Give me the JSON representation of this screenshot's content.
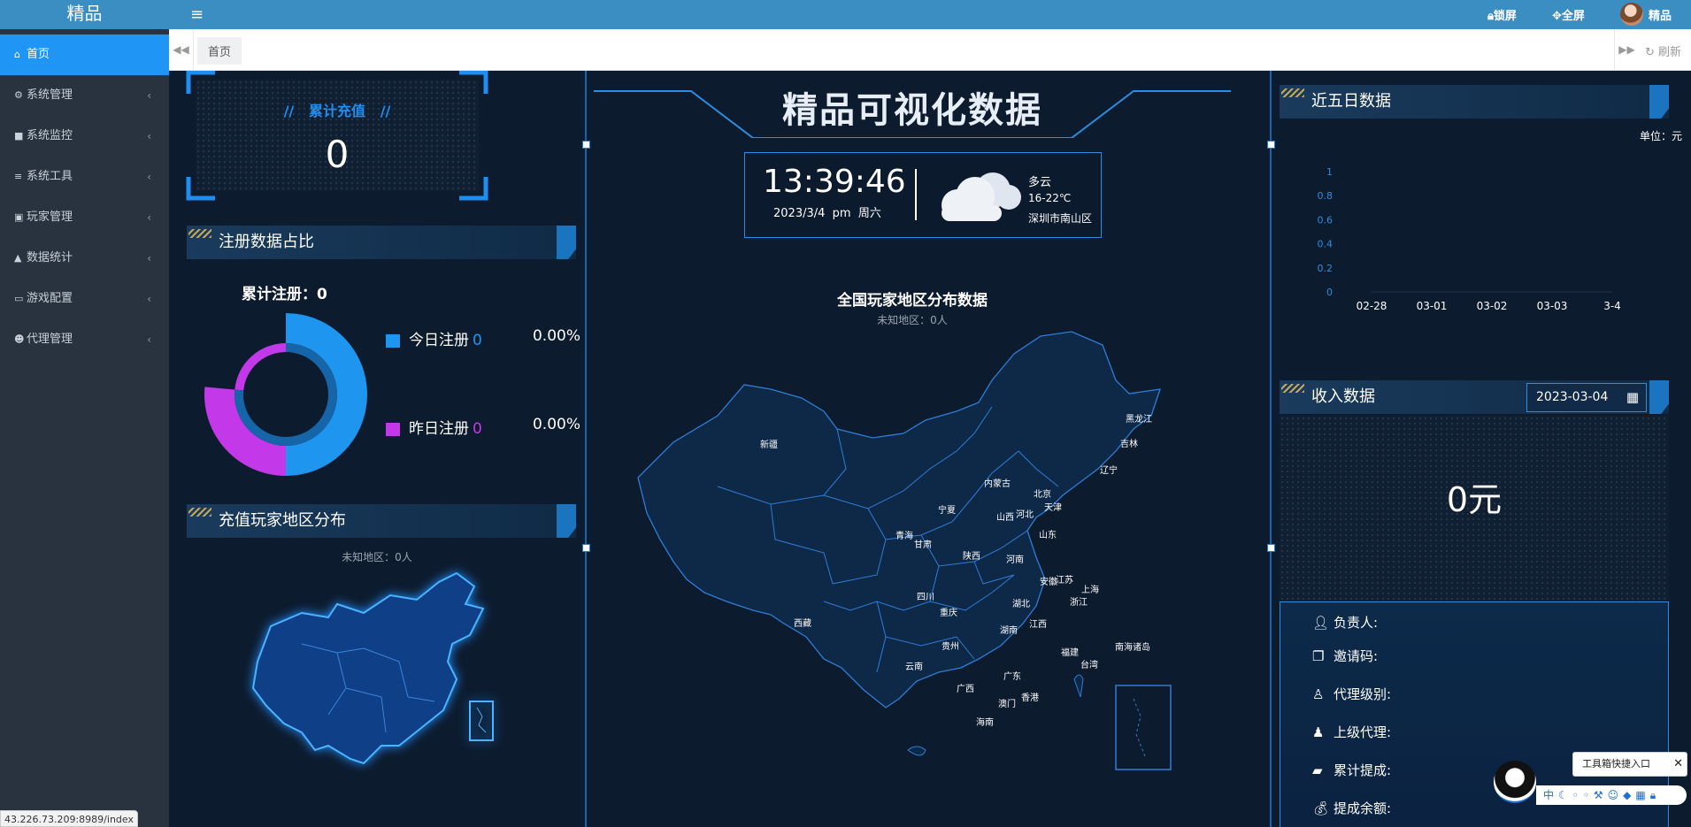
{
  "sidebar": {
    "logo": "精品",
    "items": [
      {
        "label": "首页",
        "icon": "home-icon"
      },
      {
        "label": "系统管理",
        "icon": "gear-icon"
      },
      {
        "label": "系统监控",
        "icon": "video-camera-icon"
      },
      {
        "label": "系统工具",
        "icon": "bars-icon"
      },
      {
        "label": "玩家管理",
        "icon": "id-card-icon"
      },
      {
        "label": "数据统计",
        "icon": "area-chart-icon"
      },
      {
        "label": "游戏配置",
        "icon": "desktop-icon"
      },
      {
        "label": "代理管理",
        "icon": "users-icon"
      }
    ]
  },
  "topbar": {
    "lock": "锁屏",
    "fullscreen": "全屏",
    "user": "精品"
  },
  "tabs": {
    "home": "首页",
    "refresh": "刷新"
  },
  "status_url": "43.226.73.209:8989/index",
  "recharge": {
    "title": "累计充值",
    "value": "0"
  },
  "register": {
    "title": "注册数据占比",
    "total_label": "累计注册：",
    "total_value": "0",
    "today_label": "今日注册",
    "today_value": "0",
    "today_pct": "0.00%",
    "yesterday_label": "昨日注册",
    "yesterday_value": "0",
    "yesterday_pct": "0.00%",
    "today_color": "#1e96f0",
    "yesterday_color": "#c338e8"
  },
  "recharge_region": {
    "title": "充值玩家地区分布",
    "unknown": "未知地区：0人"
  },
  "center": {
    "title": "精品可视化数据",
    "time": "13:39:46",
    "date": "2023/3/4",
    "ampm": "pm",
    "weekday": "周六",
    "weather": "多云",
    "temp": "16-22℃",
    "city": "深圳市南山区",
    "map_title": "全国玩家地区分布数据",
    "map_unknown": "未知地区：0人"
  },
  "provinces": [
    "新疆",
    "西藏",
    "青海",
    "甘肃",
    "宁夏",
    "内蒙古",
    "黑龙江",
    "吉林",
    "辽宁",
    "北京",
    "天津",
    "河北",
    "山西",
    "山东",
    "陕西",
    "河南",
    "四川",
    "重庆",
    "湖北",
    "安徽",
    "江苏",
    "上海",
    "浙江",
    "湖南",
    "江西",
    "贵州",
    "云南",
    "广西",
    "广东",
    "福建",
    "台湾",
    "香港",
    "澳门",
    "海南",
    "南海诸岛"
  ],
  "five_day": {
    "title": "近五日数据",
    "unit": "单位：元"
  },
  "chart_data": {
    "type": "line",
    "x": [
      "02-28",
      "03-01",
      "03-02",
      "03-03",
      "3-4"
    ],
    "series": [
      {
        "values": [
          0,
          0,
          0,
          0,
          0
        ]
      }
    ],
    "yticks": [
      "1",
      "0.8",
      "0.6",
      "0.4",
      "0.2",
      "0"
    ],
    "ylim": [
      0,
      1
    ]
  },
  "income": {
    "title": "收入数据",
    "date": "2023-03-04",
    "value": "0元"
  },
  "agent": {
    "items": [
      {
        "label": "负责人:",
        "icon": "user-icon"
      },
      {
        "label": "邀请码:",
        "icon": "copy-icon"
      },
      {
        "label": "代理级别:",
        "icon": "user-badge-icon"
      },
      {
        "label": "上级代理:",
        "icon": "user-up-icon"
      },
      {
        "label": "累计提成:",
        "icon": "wallet-icon"
      },
      {
        "label": "提成余额:",
        "icon": "money-bag-icon"
      }
    ]
  },
  "toolbox": {
    "label": "工具箱快捷入口"
  }
}
